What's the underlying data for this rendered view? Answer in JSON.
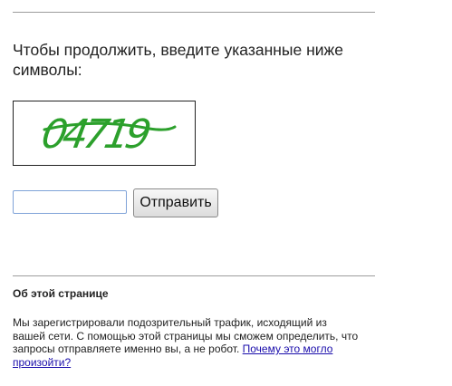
{
  "prompt": {
    "text": "Чтобы продолжить, введите указанные ниже символы:"
  },
  "captcha": {
    "code": "04719",
    "color": "#2ca02c"
  },
  "form": {
    "input_value": "",
    "submit_label": "Отправить"
  },
  "about": {
    "heading": "Об этой странице",
    "text": "Мы зарегистрировали подозрительный трафик, исходящий из вашей сети. С помощью этой страницы мы сможем определить, что запросы отправляете именно вы, а не робот. ",
    "link_text": "Почему это могло произойти?"
  }
}
